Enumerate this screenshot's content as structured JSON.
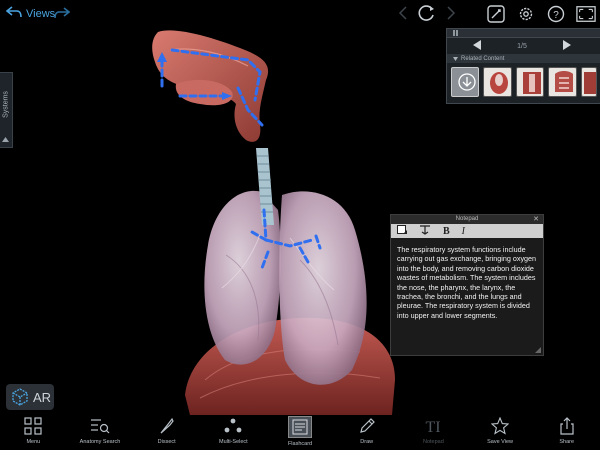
{
  "topbar": {
    "back_label": "Views",
    "page_indicator": ""
  },
  "sidebar": {
    "systems_label": "Systems"
  },
  "related": {
    "pager": "1/5",
    "header": "Related Content",
    "thumbnails": [
      "related-item-1",
      "related-item-2",
      "related-item-3",
      "related-item-4",
      "related-item-5"
    ]
  },
  "notepad": {
    "title": "Notepad",
    "bold": "B",
    "italic": "I",
    "text": "The respiratory system functions include carrying out gas exchange, bringing oxygen into the body, and removing carbon dioxide wastes of metabolism. The system includes the nose, the pharynx, the larynx, the trachea, the bronchi, and the lungs and pleurae. The respiratory system is divided into upper and lower segments."
  },
  "ar": {
    "label": "AR"
  },
  "toolbar": {
    "items": [
      {
        "label": "Menu",
        "icon": "grid-icon"
      },
      {
        "label": "Anatomy Search",
        "icon": "search-list-icon"
      },
      {
        "label": "Dissect",
        "icon": "scalpel-icon"
      },
      {
        "label": "Multi-Select",
        "icon": "multi-select-icon"
      },
      {
        "label": "Flashcard",
        "icon": "flashcard-icon"
      },
      {
        "label": "Draw",
        "icon": "pencil-icon"
      },
      {
        "label": "Notepad",
        "icon": "text-icon"
      },
      {
        "label": "Save View",
        "icon": "star-icon"
      },
      {
        "label": "Share",
        "icon": "share-icon"
      }
    ]
  },
  "colors": {
    "accent": "#4aa3df",
    "arrow_blue": "#2f6ff0",
    "muscle": "#b5504d",
    "lung": "#d9c7d6"
  }
}
